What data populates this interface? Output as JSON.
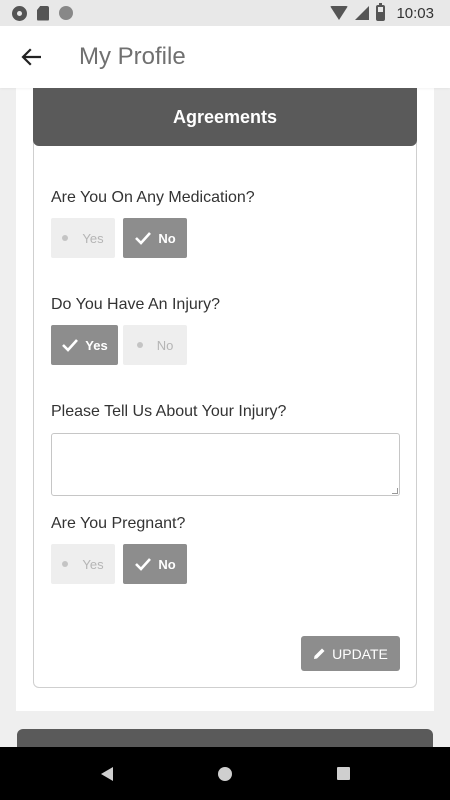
{
  "status_bar": {
    "time": "10:03",
    "left_icons": [
      "gear-icon",
      "sdcard-icon",
      "circle-icon"
    ],
    "right_icons": [
      "wifi-icon",
      "signal-icon",
      "battery-icon"
    ]
  },
  "app_bar": {
    "title": "My Profile",
    "back_icon": "arrow-left-icon"
  },
  "agreements": {
    "title": "Agreements",
    "q_medication": {
      "label": "Are You On Any Medication?",
      "yes": "Yes",
      "no": "No",
      "selected": "No"
    },
    "q_injury": {
      "label": "Do You Have An Injury?",
      "yes": "Yes",
      "no": "No",
      "selected": "Yes"
    },
    "q_injury_details": {
      "label": "Please Tell Us About Your Injury?",
      "value": ""
    },
    "q_pregnant": {
      "label": "Are You Pregnant?",
      "yes": "Yes",
      "no": "No",
      "selected": "No"
    },
    "update_label": "UPDATE"
  },
  "colors": {
    "header": "#5a5a5a",
    "selected_toggle": "#8d8d8d",
    "unselected_toggle": "#eeeeee",
    "button": "#8d8d8d"
  },
  "nav_bar": {
    "icons": [
      "nav-back-icon",
      "nav-home-icon",
      "nav-recents-icon"
    ]
  }
}
